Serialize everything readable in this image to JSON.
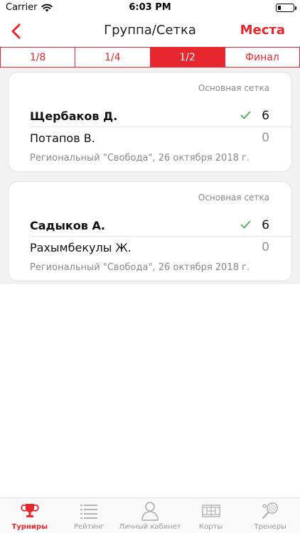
{
  "status_bar": {
    "carrier": "Carrier",
    "time": "6:03 PM",
    "battery_level": 0.2
  },
  "nav": {
    "title": "Группа/Сетка",
    "action_label": "Места"
  },
  "segments": [
    {
      "label": "1/8",
      "active": false
    },
    {
      "label": "1/4",
      "active": false
    },
    {
      "label": "1/2",
      "active": true
    },
    {
      "label": "Финал",
      "active": false
    }
  ],
  "matches": [
    {
      "type": "Основная сетка",
      "players": [
        {
          "name": "Щербаков Д.",
          "score": "6",
          "winner": true
        },
        {
          "name": "Потапов В.",
          "score": "0",
          "winner": false
        }
      ],
      "event": "Региональный \"Свобода\", 26 октября 2018 г."
    },
    {
      "type": "Основная сетка",
      "players": [
        {
          "name": "Садыков А.",
          "score": "6",
          "winner": true
        },
        {
          "name": "Рахымбекулы Ж.",
          "score": "0",
          "winner": false
        }
      ],
      "event": "Региональный \"Свобода\", 26 октября 2018 г."
    }
  ],
  "tabs": [
    {
      "label": "Турниры",
      "icon": "trophy-icon",
      "active": true
    },
    {
      "label": "Рейтинг",
      "icon": "list-icon",
      "active": false
    },
    {
      "label": "Личный кабинет",
      "icon": "person-icon",
      "active": false
    },
    {
      "label": "Корты",
      "icon": "court-icon",
      "active": false
    },
    {
      "label": "Тренеры",
      "icon": "tennis-racket-icon",
      "active": false
    }
  ],
  "colors": {
    "accent": "#e8262d",
    "win_check": "#4caf50",
    "muted_text": "#8a8a8a",
    "icon_gray": "#b5b5b5"
  }
}
